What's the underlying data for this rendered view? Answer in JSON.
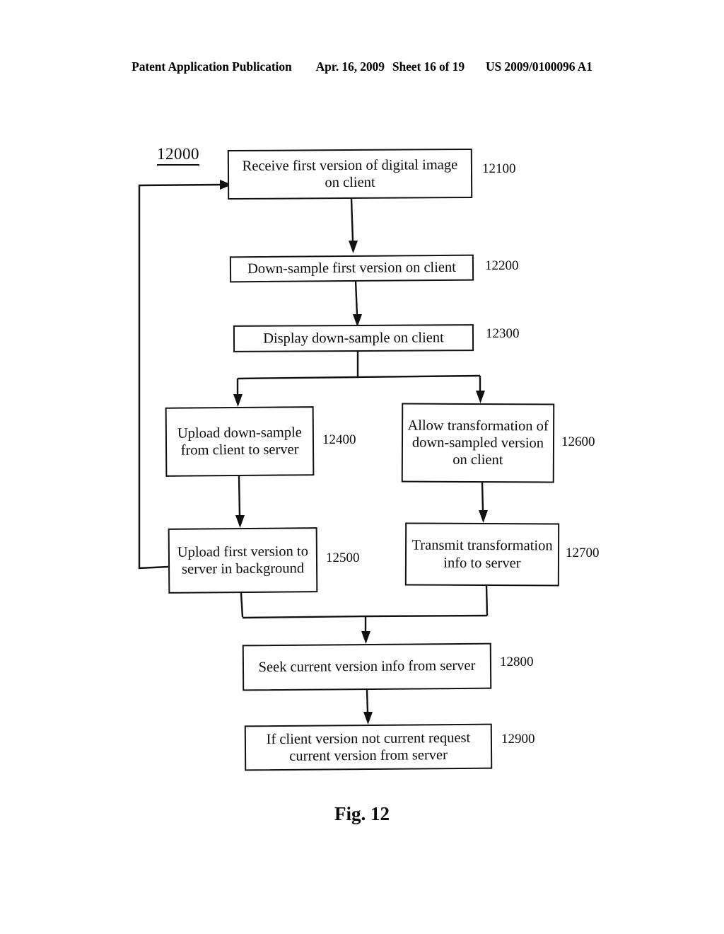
{
  "header": {
    "publication": "Patent Application Publication",
    "date": "Apr. 16, 2009",
    "sheet": "Sheet 16 of 19",
    "patent_number": "US 2009/0100096 A1"
  },
  "figure": {
    "id": "12000",
    "caption": "Fig. 12",
    "nodes": [
      {
        "ref": "12100",
        "text": "Receive first version of digital image on client"
      },
      {
        "ref": "12200",
        "text": "Down-sample first version on client"
      },
      {
        "ref": "12300",
        "text": "Display down-sample on client"
      },
      {
        "ref": "12400",
        "text": "Upload down-sample from client to server"
      },
      {
        "ref": "12500",
        "text": "Upload first version to server in background"
      },
      {
        "ref": "12600",
        "text": "Allow transformation of down-sampled version on client"
      },
      {
        "ref": "12700",
        "text": "Transmit transformation info to server"
      },
      {
        "ref": "12800",
        "text": "Seek current version info from server"
      },
      {
        "ref": "12900",
        "text": "If client version not current request current version from server"
      }
    ]
  },
  "colors": {
    "ink": "#111111",
    "paper": "#ffffff"
  }
}
